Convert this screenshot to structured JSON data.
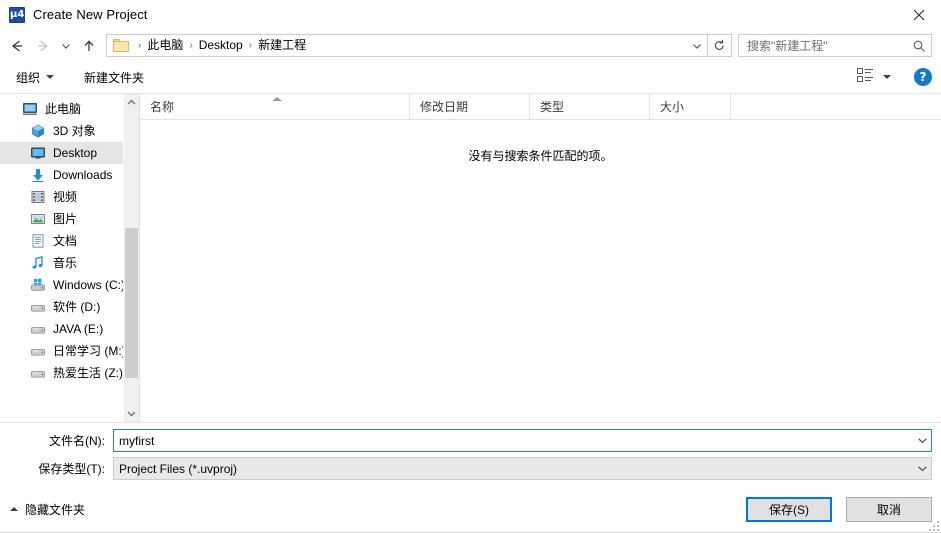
{
  "window": {
    "title": "Create New Project",
    "app_icon": "uvision-icon",
    "close_label": "✕"
  },
  "nav": {
    "back_icon": "arrow-left-icon",
    "forward_icon": "arrow-right-icon",
    "recent_icon": "chevron-down-icon",
    "up_icon": "arrow-up-icon",
    "folder_icon": "folder-icon",
    "breadcrumbs": [
      "此电脑",
      "Desktop",
      "新建工程"
    ],
    "separator": "›",
    "dropdown_icon": "chevron-down-icon",
    "refresh_icon": "refresh-icon"
  },
  "search": {
    "placeholder": "搜索\"新建工程\"",
    "icon": "search-icon"
  },
  "command_bar": {
    "organize_label": "组织",
    "new_folder_label": "新建文件夹",
    "view_icon": "view-layout-icon",
    "help_label": "?",
    "help_icon": "help-icon"
  },
  "sidebar": {
    "items": [
      {
        "label": "此电脑",
        "icon": "computer-icon",
        "indent": false,
        "selected": false
      },
      {
        "label": "3D 对象",
        "icon": "3d-objects-icon",
        "indent": true,
        "selected": false
      },
      {
        "label": "Desktop",
        "icon": "desktop-icon",
        "indent": true,
        "selected": true
      },
      {
        "label": "Downloads",
        "icon": "downloads-icon",
        "indent": true,
        "selected": false
      },
      {
        "label": "视频",
        "icon": "videos-icon",
        "indent": true,
        "selected": false
      },
      {
        "label": "图片",
        "icon": "pictures-icon",
        "indent": true,
        "selected": false
      },
      {
        "label": "文档",
        "icon": "documents-icon",
        "indent": true,
        "selected": false
      },
      {
        "label": "音乐",
        "icon": "music-icon",
        "indent": true,
        "selected": false
      },
      {
        "label": "Windows (C:)",
        "icon": "windows-drive-icon",
        "indent": true,
        "selected": false
      },
      {
        "label": "软件 (D:)",
        "icon": "drive-icon",
        "indent": true,
        "selected": false
      },
      {
        "label": "JAVA (E:)",
        "icon": "drive-icon",
        "indent": true,
        "selected": false
      },
      {
        "label": "日常学习 (M:)",
        "icon": "drive-icon",
        "indent": true,
        "selected": false
      },
      {
        "label": "热爱生活 (Z:)",
        "icon": "drive-icon",
        "indent": true,
        "selected": false
      }
    ],
    "scrollbar": {
      "up_icon": "chevron-up-icon",
      "down_icon": "chevron-down-icon"
    }
  },
  "filelist": {
    "columns": [
      {
        "key": "name",
        "label": "名称",
        "sorted": "asc"
      },
      {
        "key": "date",
        "label": "修改日期",
        "sorted": ""
      },
      {
        "key": "type",
        "label": "类型",
        "sorted": ""
      },
      {
        "key": "size",
        "label": "大小",
        "sorted": ""
      }
    ],
    "rows": [],
    "empty_message": "没有与搜索条件匹配的项。"
  },
  "form": {
    "filename_label": "文件名(N):",
    "filename_value": "myfirst",
    "filetype_label": "保存类型(T):",
    "filetype_value": "Project Files (*.uvproj)",
    "dropdown_icon": "chevron-down-icon"
  },
  "footer": {
    "hide_folders_label": "隐藏文件夹",
    "collapse_icon": "chevron-up-icon",
    "save_label": "保存(S)",
    "cancel_label": "取消",
    "resize_grip": "resize-grip-icon"
  },
  "colors": {
    "accent": "#0078d7",
    "focus_border": "#2a7fc9",
    "selection": "#e5e5e5",
    "help_blue": "#1878c8",
    "icon_blue": "#1f4e9c"
  }
}
